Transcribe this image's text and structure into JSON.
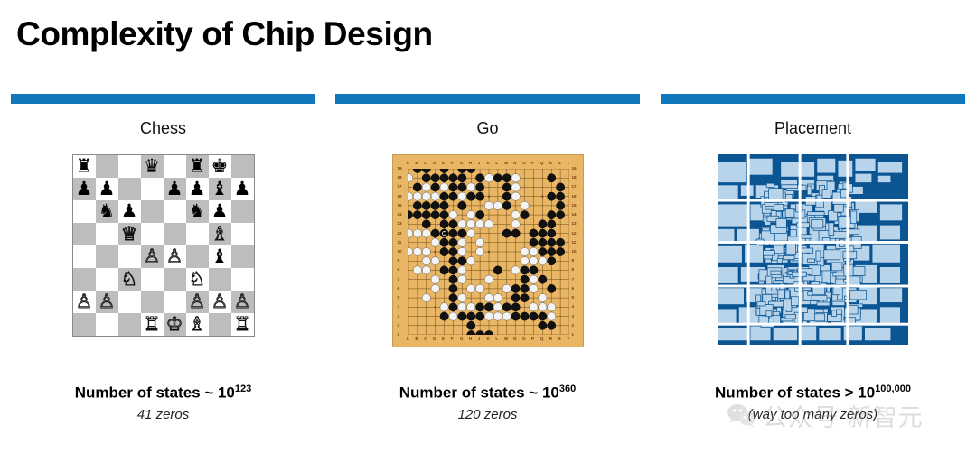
{
  "slide": {
    "title": "Complexity of Chip Design",
    "accent_color": "#1278bd"
  },
  "columns": [
    {
      "key": "chess",
      "header": "Chess",
      "caption_main": "Number of states ~ 10",
      "caption_exponent": "123",
      "caption_sub": "41 zeros"
    },
    {
      "key": "go",
      "header": "Go",
      "caption_main": "Number of states ~ 10",
      "caption_exponent": "360",
      "caption_sub": "120 zeros"
    },
    {
      "key": "placement",
      "header": "Placement",
      "caption_main": "Number of states > 10",
      "caption_exponent": "100,000",
      "caption_sub": "(way too many zeros)"
    }
  ],
  "chess_board": {
    "light_square_color": "#ffffff",
    "dark_square_color": "#bdbdbd",
    "rows": [
      [
        "br",
        "",
        "",
        "bq",
        "",
        "br",
        "bk",
        ""
      ],
      [
        "bp",
        "bp",
        "",
        "",
        "bp",
        "bp",
        "bb",
        "bp"
      ],
      [
        "",
        "bn",
        "bp",
        "",
        "",
        "bn",
        "bp",
        ""
      ],
      [
        "",
        "",
        "wq",
        "",
        "",
        "",
        "wb",
        ""
      ],
      [
        "",
        "",
        "",
        "wp",
        "wp",
        "",
        "bb",
        ""
      ],
      [
        "",
        "",
        "wn",
        "",
        "",
        "wn",
        "",
        ""
      ],
      [
        "wp",
        "wp",
        "",
        "",
        "",
        "wp",
        "wp",
        "wp"
      ],
      [
        "",
        "",
        "",
        "wr",
        "wk",
        "wb",
        "",
        "wr"
      ]
    ]
  },
  "go_board": {
    "background_color": "#e8b664",
    "size": 19,
    "column_labels": [
      "A",
      "B",
      "C",
      "D",
      "E",
      "F",
      "G",
      "H",
      "J",
      "K",
      "L",
      "M",
      "N",
      "O",
      "P",
      "Q",
      "R",
      "S",
      "T"
    ],
    "row_labels": [
      "19",
      "18",
      "17",
      "16",
      "15",
      "14",
      "13",
      "12",
      "11",
      "10",
      "9",
      "8",
      "7",
      "6",
      "5",
      "4",
      "3",
      "2",
      "1"
    ],
    "black_stones": [
      [
        1,
        18
      ],
      [
        2,
        18
      ],
      [
        4,
        18
      ],
      [
        6,
        18
      ],
      [
        7,
        18
      ],
      [
        2,
        17
      ],
      [
        3,
        17
      ],
      [
        4,
        17
      ],
      [
        5,
        17
      ],
      [
        6,
        17
      ],
      [
        8,
        17
      ],
      [
        10,
        17
      ],
      [
        11,
        17
      ],
      [
        16,
        17
      ],
      [
        1,
        16
      ],
      [
        3,
        16
      ],
      [
        5,
        16
      ],
      [
        6,
        16
      ],
      [
        8,
        16
      ],
      [
        11,
        16
      ],
      [
        17,
        16
      ],
      [
        4,
        15
      ],
      [
        5,
        15
      ],
      [
        7,
        15
      ],
      [
        8,
        15
      ],
      [
        11,
        15
      ],
      [
        16,
        15
      ],
      [
        17,
        15
      ],
      [
        1,
        14
      ],
      [
        2,
        14
      ],
      [
        3,
        14
      ],
      [
        4,
        14
      ],
      [
        6,
        14
      ],
      [
        11,
        14
      ],
      [
        17,
        14
      ],
      [
        0,
        13
      ],
      [
        1,
        13
      ],
      [
        2,
        13
      ],
      [
        3,
        13
      ],
      [
        4,
        13
      ],
      [
        8,
        13
      ],
      [
        13,
        13
      ],
      [
        16,
        13
      ],
      [
        17,
        13
      ],
      [
        2,
        12
      ],
      [
        4,
        12
      ],
      [
        5,
        12
      ],
      [
        15,
        12
      ],
      [
        16,
        12
      ],
      [
        3,
        11
      ],
      [
        4,
        11
      ],
      [
        5,
        11
      ],
      [
        6,
        11
      ],
      [
        11,
        11
      ],
      [
        12,
        11
      ],
      [
        14,
        11
      ],
      [
        15,
        11
      ],
      [
        16,
        11
      ],
      [
        4,
        10
      ],
      [
        5,
        10
      ],
      [
        14,
        10
      ],
      [
        15,
        10
      ],
      [
        16,
        10
      ],
      [
        17,
        10
      ],
      [
        4,
        9
      ],
      [
        5,
        9
      ],
      [
        15,
        9
      ],
      [
        16,
        9
      ],
      [
        17,
        9
      ],
      [
        5,
        8
      ],
      [
        6,
        8
      ],
      [
        16,
        8
      ],
      [
        4,
        7
      ],
      [
        5,
        7
      ],
      [
        10,
        7
      ],
      [
        13,
        7
      ],
      [
        14,
        7
      ],
      [
        5,
        6
      ],
      [
        13,
        6
      ],
      [
        15,
        6
      ],
      [
        5,
        5
      ],
      [
        12,
        5
      ],
      [
        13,
        5
      ],
      [
        16,
        5
      ],
      [
        5,
        4
      ],
      [
        12,
        4
      ],
      [
        13,
        4
      ],
      [
        5,
        3
      ],
      [
        8,
        3
      ],
      [
        9,
        3
      ],
      [
        11,
        3
      ],
      [
        12,
        3
      ],
      [
        4,
        2
      ],
      [
        6,
        2
      ],
      [
        7,
        2
      ],
      [
        8,
        2
      ],
      [
        12,
        2
      ],
      [
        13,
        2
      ],
      [
        14,
        2
      ],
      [
        15,
        2
      ],
      [
        7,
        1
      ],
      [
        15,
        1
      ],
      [
        16,
        1
      ],
      [
        7,
        0
      ],
      [
        8,
        0
      ],
      [
        9,
        0
      ]
    ],
    "white_stones": [
      [
        0,
        17
      ],
      [
        2,
        17
      ],
      [
        9,
        17
      ],
      [
        12,
        17
      ],
      [
        1,
        16
      ],
      [
        2,
        16
      ],
      [
        4,
        16
      ],
      [
        7,
        16
      ],
      [
        12,
        16
      ],
      [
        0,
        15
      ],
      [
        1,
        15
      ],
      [
        2,
        15
      ],
      [
        3,
        15
      ],
      [
        6,
        15
      ],
      [
        7,
        15
      ],
      [
        12,
        15
      ],
      [
        3,
        14
      ],
      [
        6,
        14
      ],
      [
        9,
        14
      ],
      [
        10,
        14
      ],
      [
        13,
        14
      ],
      [
        5,
        13
      ],
      [
        7,
        13
      ],
      [
        8,
        13
      ],
      [
        12,
        13
      ],
      [
        6,
        12
      ],
      [
        7,
        12
      ],
      [
        8,
        12
      ],
      [
        9,
        12
      ],
      [
        12,
        12
      ],
      [
        0,
        11
      ],
      [
        1,
        11
      ],
      [
        2,
        11
      ],
      [
        7,
        11
      ],
      [
        3,
        10
      ],
      [
        6,
        10
      ],
      [
        8,
        10
      ],
      [
        0,
        9
      ],
      [
        1,
        9
      ],
      [
        2,
        9
      ],
      [
        4,
        9
      ],
      [
        6,
        9
      ],
      [
        8,
        9
      ],
      [
        13,
        9
      ],
      [
        14,
        9
      ],
      [
        2,
        8
      ],
      [
        3,
        8
      ],
      [
        6,
        8
      ],
      [
        7,
        8
      ],
      [
        13,
        8
      ],
      [
        14,
        8
      ],
      [
        15,
        8
      ],
      [
        1,
        7
      ],
      [
        2,
        7
      ],
      [
        4,
        7
      ],
      [
        6,
        7
      ],
      [
        12,
        7
      ],
      [
        14,
        7
      ],
      [
        3,
        6
      ],
      [
        6,
        6
      ],
      [
        9,
        6
      ],
      [
        14,
        6
      ],
      [
        3,
        5
      ],
      [
        7,
        5
      ],
      [
        8,
        5
      ],
      [
        11,
        5
      ],
      [
        14,
        5
      ],
      [
        2,
        4
      ],
      [
        6,
        4
      ],
      [
        9,
        4
      ],
      [
        10,
        4
      ],
      [
        15,
        4
      ],
      [
        4,
        3
      ],
      [
        6,
        3
      ],
      [
        7,
        3
      ],
      [
        10,
        3
      ],
      [
        14,
        3
      ],
      [
        15,
        3
      ],
      [
        16,
        3
      ],
      [
        5,
        2
      ],
      [
        9,
        2
      ],
      [
        10,
        2
      ],
      [
        11,
        2
      ],
      [
        16,
        2
      ]
    ],
    "marked_stone": [
      4,
      11
    ]
  },
  "placement": {
    "background_color": "#0b5593",
    "block_color": "#b8d4ea",
    "block_edge_color": "#0b5593",
    "channel_color": "#ffffff",
    "blocks": [
      [
        0,
        4,
        15,
        11
      ],
      [
        16,
        2,
        13,
        9
      ],
      [
        0,
        16,
        11,
        8
      ],
      [
        12,
        16,
        7,
        6
      ],
      [
        20,
        16,
        12,
        7
      ],
      [
        33,
        4,
        18,
        8
      ],
      [
        33,
        13,
        9,
        5
      ],
      [
        43,
        13,
        8,
        6
      ],
      [
        52,
        2,
        10,
        8
      ],
      [
        52,
        11,
        9,
        5
      ],
      [
        63,
        3,
        8,
        9
      ],
      [
        72,
        2,
        11,
        7
      ],
      [
        72,
        10,
        9,
        5
      ],
      [
        84,
        4,
        13,
        6
      ],
      [
        84,
        11,
        7,
        4
      ],
      [
        0,
        26,
        16,
        12
      ],
      [
        17,
        26,
        10,
        9
      ],
      [
        28,
        24,
        9,
        11
      ],
      [
        38,
        26,
        12,
        9
      ],
      [
        51,
        24,
        9,
        8
      ],
      [
        61,
        26,
        10,
        10
      ],
      [
        72,
        24,
        12,
        7
      ],
      [
        85,
        26,
        12,
        9
      ],
      [
        0,
        39,
        9,
        7
      ],
      [
        10,
        39,
        12,
        8
      ],
      [
        23,
        38,
        14,
        10
      ],
      [
        38,
        37,
        9,
        9
      ],
      [
        48,
        36,
        11,
        10
      ],
      [
        60,
        38,
        10,
        8
      ],
      [
        71,
        37,
        13,
        9
      ],
      [
        85,
        37,
        11,
        8
      ],
      [
        0,
        48,
        13,
        9
      ],
      [
        14,
        47,
        10,
        10
      ],
      [
        25,
        49,
        12,
        8
      ],
      [
        38,
        48,
        9,
        9
      ],
      [
        48,
        47,
        8,
        10
      ],
      [
        57,
        48,
        13,
        9
      ],
      [
        71,
        48,
        9,
        8
      ],
      [
        81,
        47,
        15,
        10
      ],
      [
        0,
        59,
        11,
        9
      ],
      [
        12,
        59,
        13,
        8
      ],
      [
        26,
        58,
        9,
        10
      ],
      [
        36,
        59,
        12,
        9
      ],
      [
        49,
        58,
        10,
        10
      ],
      [
        60,
        59,
        11,
        8
      ],
      [
        72,
        58,
        12,
        10
      ],
      [
        85,
        59,
        11,
        9
      ],
      [
        0,
        70,
        14,
        9
      ],
      [
        15,
        70,
        9,
        8
      ],
      [
        25,
        69,
        11,
        10
      ],
      [
        37,
        70,
        12,
        9
      ],
      [
        50,
        69,
        9,
        9
      ],
      [
        60,
        70,
        13,
        8
      ],
      [
        74,
        69,
        10,
        10
      ],
      [
        85,
        70,
        12,
        8
      ],
      [
        0,
        81,
        10,
        8
      ],
      [
        11,
        80,
        12,
        9
      ],
      [
        24,
        81,
        9,
        8
      ],
      [
        34,
        80,
        13,
        10
      ],
      [
        48,
        81,
        10,
        8
      ],
      [
        59,
        80,
        11,
        9
      ],
      [
        71,
        81,
        13,
        8
      ],
      [
        85,
        80,
        11,
        9
      ],
      [
        0,
        91,
        16,
        7
      ],
      [
        17,
        90,
        11,
        8
      ],
      [
        29,
        91,
        13,
        7
      ],
      [
        43,
        90,
        9,
        8
      ],
      [
        53,
        91,
        12,
        7
      ],
      [
        66,
        90,
        10,
        8
      ],
      [
        77,
        91,
        14,
        7
      ]
    ]
  },
  "watermark": {
    "text": "公众号 新智元",
    "logo": "wechat-logo"
  }
}
